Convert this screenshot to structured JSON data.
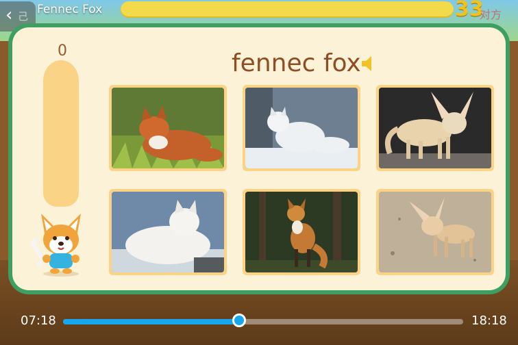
{
  "header": {
    "title": "Fennec Fox",
    "score": "33",
    "back_icon": "‹",
    "ghost_left": "己方",
    "ghost_right": "对方"
  },
  "quiz": {
    "word": "fennec fox",
    "player_score": "0",
    "speaker_icon": "speaker-icon",
    "meter_level": 0
  },
  "choices": [
    {
      "label": "red-fox-lying"
    },
    {
      "label": "arctic-fox-snow"
    },
    {
      "label": "fennec-fox-standing"
    },
    {
      "label": "arctic-fox-resting"
    },
    {
      "label": "red-fox-forest"
    },
    {
      "label": "fennec-fox-sand"
    }
  ],
  "player": {
    "time_current": "07:18",
    "time_total": "18:18",
    "progress": 0.44
  },
  "colors": {
    "card_border": "#3f9f63",
    "card_bg": "#fcf2d8",
    "accent_blue": "#16a6ee",
    "word_brown": "#8e4d22"
  }
}
